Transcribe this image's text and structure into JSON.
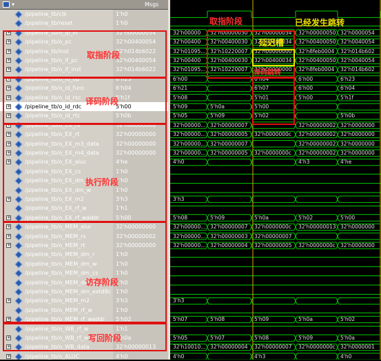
{
  "window": {
    "header_msgs": "Msgs"
  },
  "signals": [
    {
      "name": "/pipeline_tb/clk",
      "value": "1'h0",
      "bus": false
    },
    {
      "name": "/pipeline_tb/reset",
      "value": "1'h0",
      "bus": false
    },
    {
      "name": "/pipeline_tb/o_ip_in",
      "value": "32'h00000054",
      "bus": true
    },
    {
      "name": "/pipeline_tb/o_pc",
      "value": "32'h00400054",
      "bus": true
    },
    {
      "name": "/pipeline_tb/inst",
      "value": "32'h014b6022",
      "bus": true
    },
    {
      "name": "/pipeline_tb/o_if_pc",
      "value": "32'h00400054",
      "bus": true
    },
    {
      "name": "/pipeline_tb/o_if_inst",
      "value": "32'h014b6022",
      "bus": true
    },
    {
      "name": "/pipeline_tb/o_id_op",
      "value": "6'h23",
      "bus": true
    },
    {
      "name": "/pipeline_tb/o_id_func",
      "value": "6'h04",
      "bus": true
    },
    {
      "name": "/pipeline_tb/o_id_rsc",
      "value": "5'h1f",
      "bus": true
    },
    {
      "name": "/pipeline_tb/o_id_rdc",
      "value": "5'h00",
      "bus": true,
      "selected": true
    },
    {
      "name": "/pipeline_tb/o_id_rtc",
      "value": "5'h0b",
      "bus": true
    },
    {
      "name": "/pipeline_tb/o_EX_rs",
      "value": "32'h00000000",
      "bus": true
    },
    {
      "name": "/pipeline_tb/o_EX_rt",
      "value": "32'h00000000",
      "bus": true
    },
    {
      "name": "/pipeline_tb/o_EX_m3_data",
      "value": "32'h00000000",
      "bus": true
    },
    {
      "name": "/pipeline_tb/o_EX_m4_data",
      "value": "32'h00000000",
      "bus": true
    },
    {
      "name": "/pipeline_tb/o_EX_aluc",
      "value": "4'he",
      "bus": true
    },
    {
      "name": "/pipeline_tb/o_EX_cs",
      "value": "1'h0",
      "bus": false
    },
    {
      "name": "/pipeline_tb/o_EX_dm_r",
      "value": "1'h0",
      "bus": false
    },
    {
      "name": "/pipeline_tb/o_EX_dm_w",
      "value": "1'h0",
      "bus": false
    },
    {
      "name": "/pipeline_tb/o_EX_m2",
      "value": "3'h3",
      "bus": true
    },
    {
      "name": "/pipeline_tb/o_EX_rf_w",
      "value": "1'h1",
      "bus": false
    },
    {
      "name": "/pipeline_tb/o_EX_rf_waddr",
      "value": "5'h00",
      "bus": true
    },
    {
      "name": "/pipeline_tb/o_MEM_alur",
      "value": "32'h00000000",
      "bus": true
    },
    {
      "name": "/pipeline_tb/o_MEM_rs",
      "value": "32'h00000002",
      "bus": true
    },
    {
      "name": "/pipeline_tb/o_MEM_rt",
      "value": "32'h00000000",
      "bus": true
    },
    {
      "name": "/pipeline_tb/o_MEM_dm_r",
      "value": "1'h0",
      "bus": false
    },
    {
      "name": "/pipeline_tb/o_MEM_dm_w",
      "value": "1'h0",
      "bus": false
    },
    {
      "name": "/pipeline_tb/o_MEM_dm_cs",
      "value": "1'h0",
      "bus": false
    },
    {
      "name": "/pipeline_tb/o_MEM_dm_sb",
      "value": "1'h0",
      "bus": false
    },
    {
      "name": "/pipeline_tb/o_MEM_dm_extd8c",
      "value": "1'h0",
      "bus": false
    },
    {
      "name": "/pipeline_tb/o_MEM_m2",
      "value": "3'h3",
      "bus": true
    },
    {
      "name": "/pipeline_tb/o_MEM_rf_w",
      "value": "1'h0",
      "bus": false
    },
    {
      "name": "/pipeline_tb/o_MEM_rf_waddr",
      "value": "5'h02",
      "bus": true
    },
    {
      "name": "/pipeline_tb/o_WB_rf_w",
      "value": "1'h1",
      "bus": false
    },
    {
      "name": "/pipeline_tb/o_WB_rf_waddr",
      "value": "5'h0a",
      "bus": true
    },
    {
      "name": "/pipeline_tb/o_WB_data",
      "value": "32'h00000013",
      "bus": true
    },
    {
      "name": "/pipeline_tb/o_ALUC",
      "value": "4'h0",
      "bus": true
    }
  ],
  "stage_labels": {
    "fetch": "取指阶段",
    "decode": "译码阶段",
    "execute": "执行阶段",
    "memory": "访存阶段",
    "writeback": "写回阶段"
  },
  "annotations": {
    "fetch_wave": "取指阶段",
    "jump": "已经发生跳转",
    "delay_slot": "延迟槽",
    "jump_detect": "译码跳转"
  },
  "waveforms": [
    {
      "row": 2,
      "segments": [
        "32'h00000",
        "32'h00000030",
        "32'h00000034",
        "32'h00000050",
        "32'h0000054"
      ]
    },
    {
      "row": 3,
      "segments": [
        "32'h00400",
        "32'h00400030",
        "32'h00400034",
        "32'h00400050",
        "32'h0040054"
      ]
    },
    {
      "row": 4,
      "segments": [
        "32'h01095...",
        "32'h10220007",
        "32'h00000000",
        "32'h8feb0004",
        "32'h014b602"
      ]
    },
    {
      "row": 5,
      "segments": [
        "32'h00400",
        "32'h00400030",
        "32'h00400034",
        "32'h00400050",
        "32'h0040054"
      ]
    },
    {
      "row": 6,
      "segments": [
        "32'h01095...",
        "32'h10220007",
        "32'h00000000",
        "32'h8feb0004",
        "32'h014b602"
      ]
    },
    {
      "row": 7,
      "segments": [
        "6'h00",
        "",
        "6'h04",
        "6'h00",
        "6'h23"
      ]
    },
    {
      "row": 8,
      "segments": [
        "6'h21",
        "",
        "6'h07",
        "6'h00",
        "6'h04"
      ]
    },
    {
      "row": 9,
      "segments": [
        "5'h08",
        "",
        "5'h01",
        "5'h00",
        "5'h1f"
      ]
    },
    {
      "row": 10,
      "segments": [
        "5'h09",
        "5'h0a",
        "5'h00",
        "",
        ""
      ]
    },
    {
      "row": 11,
      "segments": [
        "5'h05",
        "5'h09",
        "5'h02",
        "",
        "5'h0b"
      ]
    },
    {
      "row": 12,
      "segments": [
        "32'h00000...",
        "32'h00000007",
        "",
        "32'h00000002",
        "32'h0000000"
      ]
    },
    {
      "row": 13,
      "segments": [
        "32'h00000...",
        "32'h00000005",
        "32'h0000000c",
        "32'h00000002",
        "32'h0000000"
      ]
    },
    {
      "row": 14,
      "segments": [
        "32'h00000...",
        "32'h00000007",
        "",
        "32'h00000002",
        "32'h0000000"
      ]
    },
    {
      "row": 15,
      "segments": [
        "32'h00000...",
        "32'h00000005",
        "32'h0000000c",
        "32'h00000002",
        "32'h0000000"
      ]
    },
    {
      "row": 16,
      "segments": [
        "4'h0",
        "",
        "",
        "4'h3",
        "4'he"
      ]
    },
    {
      "row": 20,
      "segments": [
        "3'h3",
        "",
        "",
        "",
        ""
      ]
    },
    {
      "row": 22,
      "segments": [
        "5'h08",
        "5'h09",
        "5'h0a",
        "5'h02",
        "5'h00"
      ]
    },
    {
      "row": 23,
      "segments": [
        "32'h00000...",
        "32'h00000007",
        "32'h0000000c",
        "32'h00000013",
        "32'h0000000"
      ]
    },
    {
      "row": 24,
      "segments": [
        "32'h00000...",
        "32'h00000003",
        "32'h00000007",
        "",
        ""
      ]
    },
    {
      "row": 25,
      "segments": [
        "32'h00000...",
        "32'h00000004",
        "32'h00000005",
        "32'h0000000c",
        "32'h0000000"
      ]
    },
    {
      "row": 31,
      "segments": [
        "3'h3",
        "",
        "",
        "",
        ""
      ]
    },
    {
      "row": 33,
      "segments": [
        "5'h07",
        "5'h08",
        "5'h09",
        "5'h0a",
        "5'h02"
      ]
    },
    {
      "row": 35,
      "segments": [
        "5'h05",
        "5'h07",
        "5'h08",
        "5'h09",
        "5'h0a"
      ]
    },
    {
      "row": 36,
      "segments": [
        "32'h10010...",
        "32'h00000004",
        "32'h00000007",
        "32'h0000000c",
        "32'h0000001"
      ]
    },
    {
      "row": 37,
      "segments": [
        "4'h0",
        "",
        "4'h3",
        "",
        "4'h0"
      ]
    }
  ],
  "colors": {
    "wave_green": "#00d000",
    "box_red": "#e01010",
    "note_yellow": "#f0e000",
    "cursor_gold": "#d4b000"
  }
}
